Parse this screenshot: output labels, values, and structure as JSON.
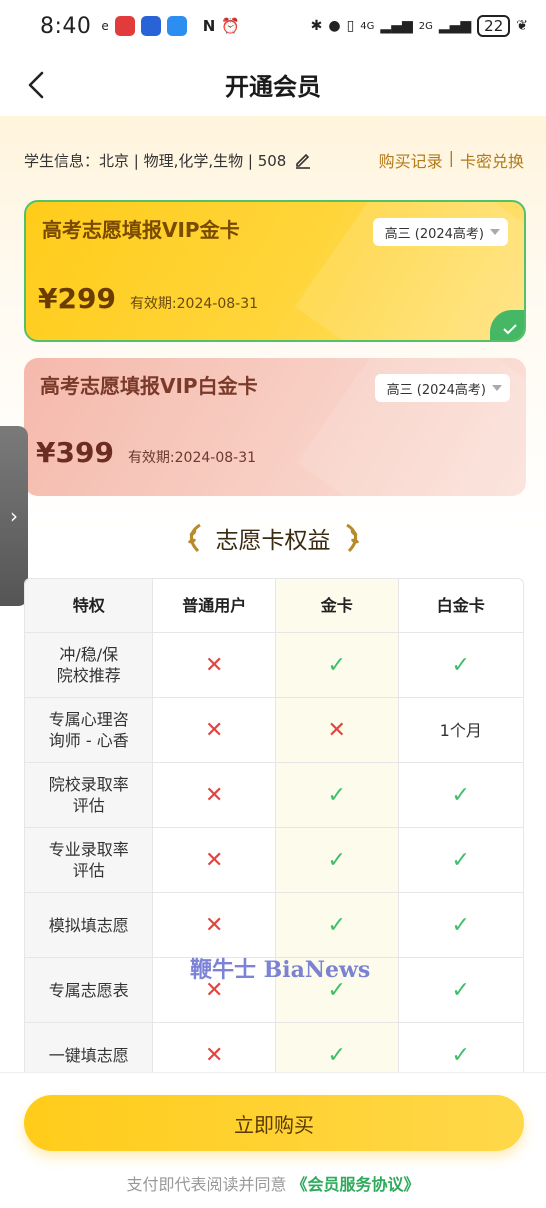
{
  "status_bar": {
    "time": "8:40",
    "signal_text_1": "4G",
    "signal_text_2": "2G",
    "battery": "22"
  },
  "header": {
    "title": "开通会员"
  },
  "info": {
    "student_info": "学生信息：北京 | 物理,化学,生物 | 508",
    "purchase_history": "购买记录",
    "separator": "|",
    "redeem": "卡密兑换"
  },
  "cards": [
    {
      "title": "高考志愿填报VIP金卡",
      "grade": "高三 (2024高考)",
      "price": "¥299",
      "validity": "有效期:2024-08-31",
      "selected": true
    },
    {
      "title": "高考志愿填报VIP白金卡",
      "grade": "高三 (2024高考)",
      "price": "¥399",
      "validity": "有效期:2024-08-31",
      "selected": false
    }
  ],
  "benefits": {
    "title": "志愿卡权益",
    "headers": [
      "特权",
      "普通用户",
      "金卡",
      "白金卡"
    ],
    "rows": [
      {
        "name": "冲/稳/保\n院校推荐",
        "normal": "x",
        "gold": "v",
        "platinum": "v"
      },
      {
        "name": "专属心理咨\n询师 - 心香",
        "normal": "x",
        "gold": "x",
        "platinum": "1个月"
      },
      {
        "name": "院校录取率\n评估",
        "normal": "x",
        "gold": "v",
        "platinum": "v"
      },
      {
        "name": "专业录取率\n评估",
        "normal": "x",
        "gold": "v",
        "platinum": "v"
      },
      {
        "name": "模拟填志愿",
        "normal": "x",
        "gold": "v",
        "platinum": "v"
      },
      {
        "name": "专属志愿表",
        "normal": "x",
        "gold": "v",
        "platinum": "v"
      },
      {
        "name": "一键填志愿",
        "normal": "x",
        "gold": "v",
        "platinum": "v"
      }
    ]
  },
  "watermark": "鞭牛士 BiaNews",
  "bottom": {
    "buy_label": "立即购买",
    "agreement_prefix": "支付即代表阅读并同意",
    "agreement_link": "《会员服务协议》"
  },
  "colors": {
    "gold": "#ffcc1a",
    "platinum": "#f5b9ac",
    "check": "#3fbf6a",
    "cross": "#e0463f",
    "link": "#2eaa5a"
  }
}
